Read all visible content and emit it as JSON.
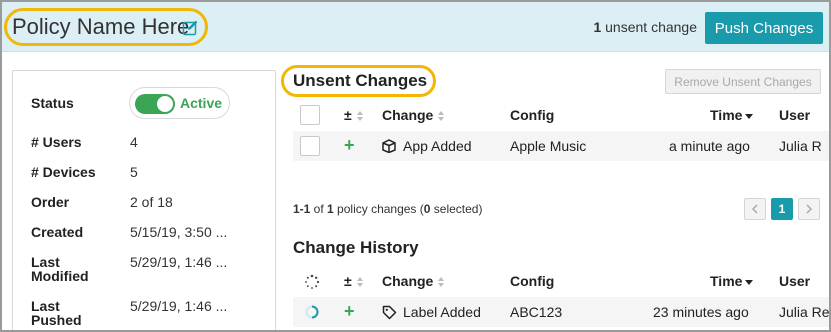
{
  "header": {
    "policy_name": "Policy Name Here",
    "unsent_count": "1",
    "unsent_suffix": " unsent change",
    "push_label": "Push Changes"
  },
  "colors": {
    "accent": "#1a9bab",
    "active_green": "#3aa655",
    "highlight": "#f2b705",
    "header_bg": "#dbeff5"
  },
  "details": {
    "status_label": "Status",
    "status_value": "Active",
    "status_on": true,
    "users_label": "# Users",
    "users_value": "4",
    "devices_label": "# Devices",
    "devices_value": "5",
    "order_label": "Order",
    "order_value": "2 of 18",
    "created_label": "Created",
    "created_value": "5/15/19, 3:50 ...",
    "modified_label_1": "Last",
    "modified_label_2": "Modified",
    "modified_value": "5/29/19, 1:46 ...",
    "pushed_label_1": "Last",
    "pushed_label_2": "Pushed",
    "pushed_value": "5/29/19, 1:46 ..."
  },
  "unsent": {
    "title": "Unsent Changes",
    "remove_label": "Remove Unsent Changes",
    "columns": {
      "pm": "±",
      "change": "Change",
      "config": "Config",
      "time": "Time",
      "user": "User"
    },
    "rows": [
      {
        "change": "App Added",
        "change_icon": "package-icon",
        "config": "Apple Music",
        "time": "a minute ago",
        "user": "Julia R"
      }
    ],
    "pager_range": "1-1",
    "pager_of": " of ",
    "pager_total": "1",
    "pager_mid": " policy changes (",
    "pager_selected": "0",
    "pager_end": " selected)",
    "page_current": "1",
    "prev_icon": "chevron-left-icon",
    "next_icon": "chevron-right-icon"
  },
  "history": {
    "title": "Change History",
    "columns": {
      "pm": "±",
      "change": "Change",
      "config": "Config",
      "time": "Time",
      "user": "User"
    },
    "rows": [
      {
        "change": "Label Added",
        "change_icon": "tag-icon",
        "config": "ABC123",
        "time": "23 minutes ago",
        "user": "Julia Re"
      }
    ]
  }
}
